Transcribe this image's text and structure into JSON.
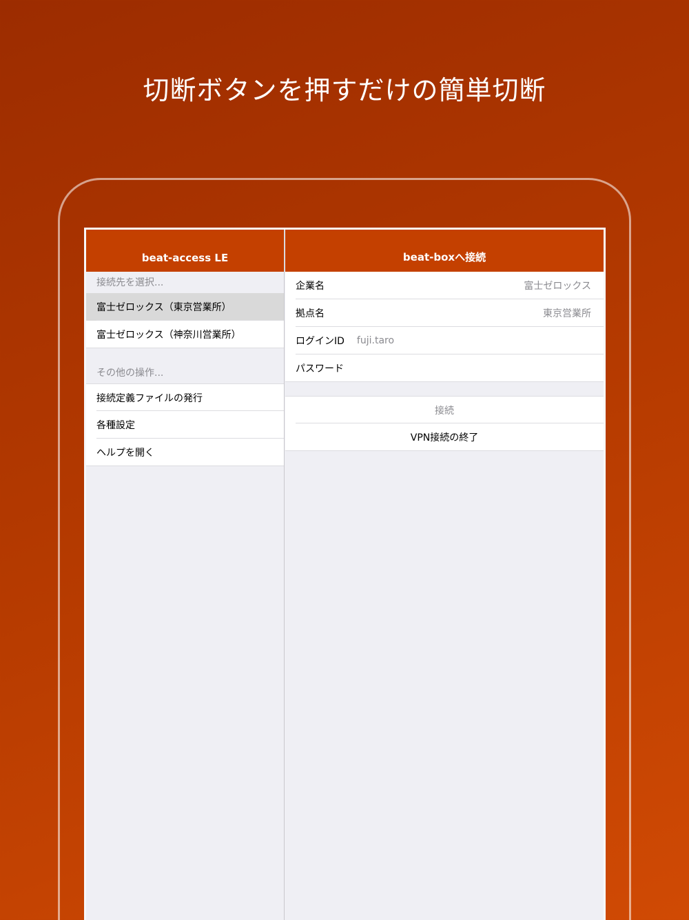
{
  "headline": "切断ボタンを押すだけの簡単切断",
  "left_pane": {
    "title": "beat-access LE",
    "select_header": "接続先を選択...",
    "destinations": [
      "富士ゼロックス（東京営業所）",
      "富士ゼロックス（神奈川営業所）"
    ],
    "other_header": "その他の操作...",
    "actions": [
      "接続定義ファイルの発行",
      "各種設定",
      "ヘルプを開く"
    ]
  },
  "right_pane": {
    "title": "beat-boxへ接続",
    "fields": [
      {
        "label": "企業名",
        "value": "富士ゼロックス"
      },
      {
        "label": "拠点名",
        "value": "東京営業所"
      },
      {
        "label": "ログインID",
        "value": "fuji.taro"
      },
      {
        "label": "パスワード",
        "value": ""
      }
    ],
    "connect_label": "接続",
    "disconnect_label": "VPN接続の終了"
  },
  "colors": {
    "navbar": "#c44000",
    "background_top": "#9c2c00",
    "background_bottom": "#d04a04",
    "selected_row": "#d9d9d9"
  }
}
